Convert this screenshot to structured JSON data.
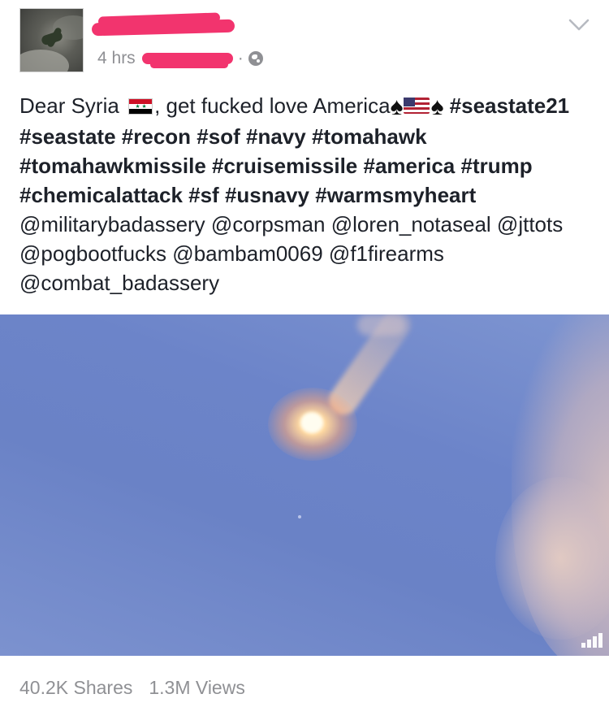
{
  "post": {
    "time": "4 hrs",
    "separator": "·",
    "caption": {
      "lead": "Dear Syria",
      "mid": ", get fucked love America",
      "hashtags": [
        "#seastate21",
        "#seastate",
        "#recon",
        "#sof",
        "#navy",
        "#tomahawk",
        "#tomahawkmissile",
        "#cruisemissile",
        "#america",
        "#trump",
        "#chemicalattack",
        "#sf",
        "#usnavy",
        "#warmsmyheart"
      ],
      "mentions": [
        "@militarybadassery",
        "@corpsman",
        "@loren_notaseal",
        "@jttots",
        "@pogbootfucks",
        "@bambam0069",
        "@f1firearms",
        "@combat_badassery"
      ]
    },
    "icons": {
      "privacy": "globe-icon",
      "menu": "chevron-down-icon",
      "video_indicator": "signal-icon"
    },
    "colors": {
      "redaction": "#f2346e",
      "meta_text": "#8f9094"
    }
  },
  "stats": {
    "shares": "40.2K Shares",
    "views": "1.3M Views"
  }
}
